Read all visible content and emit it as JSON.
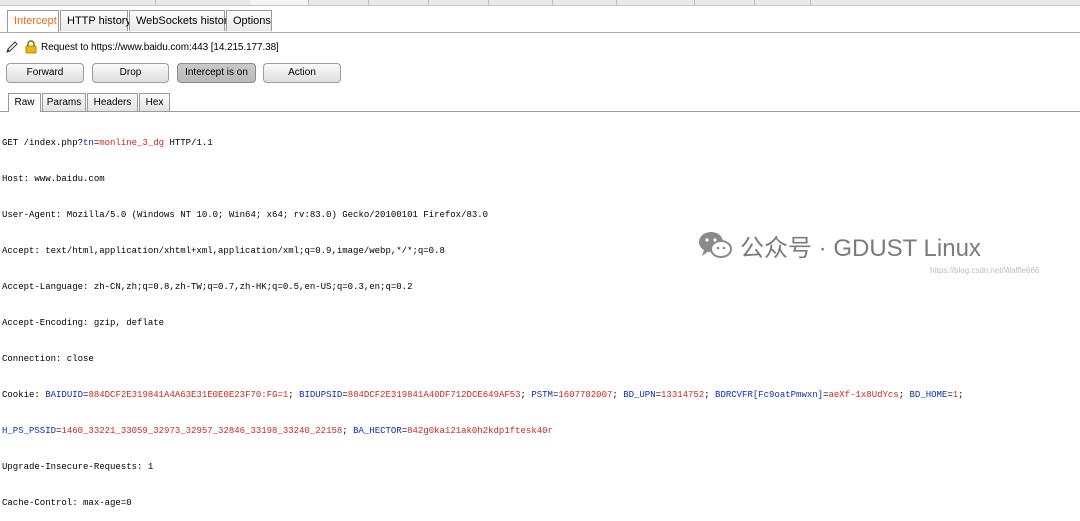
{
  "top_tabs": [
    "Intercept",
    "HTTP history",
    "WebSockets history",
    "Options"
  ],
  "request_label": "Request to https://www.baidu.com:443  [14.215.177.38]",
  "buttons": {
    "forward": "Forward",
    "drop": "Drop",
    "intercept": "Intercept is on",
    "action": "Action"
  },
  "view_tabs": [
    "Raw",
    "Params",
    "Headers",
    "Hex"
  ],
  "request": {
    "line1": {
      "pre": "GET /index.php?",
      "k": "tn",
      "eq": "=",
      "v": "monline_3_dg",
      "post": " HTTP/1.1"
    },
    "host": "Host: www.baidu.com",
    "ua": "User-Agent: Mozilla/5.0 (Windows NT 10.0; Win64; x64; rv:83.0) Gecko/20100101 Firefox/83.0",
    "accept": "Accept: text/html,application/xhtml+xml,application/xml;q=0.9,image/webp,*/*;q=0.8",
    "lang": "Accept-Language: zh-CN,zh;q=0.8,zh-TW;q=0.7,zh-HK;q=0.5,en-US;q=0.3,en;q=0.2",
    "enc": "Accept-Encoding: gzip, deflate",
    "conn": "Connection: close",
    "cookie_prefix": "Cookie: ",
    "cookies1": [
      {
        "k": "BAIDUID",
        "v": "884DCF2E319841A4A63E31E0E0E23F70:FG=1"
      },
      {
        "k": "BIDUPSID",
        "v": "884DCF2E319841A40DF712DCE649AF53"
      },
      {
        "k": "PSTM",
        "v": "1607782007"
      },
      {
        "k": "BD_UPN",
        "v": "13314752"
      },
      {
        "k": "BDRCVFR[Fc9oatPmwxn]",
        "v": "aeXf-1x8UdYcs"
      },
      {
        "k": "BD_HOME",
        "v": "1"
      }
    ],
    "cookies2": [
      {
        "k": "H_PS_PSSID",
        "v": "1460_33221_33059_32973_32957_32846_33198_33240_22158"
      },
      {
        "k": "BA_HECTOR",
        "v": "842g0ka121ak0h2kdp1ftesk40r"
      }
    ],
    "upgrade": "Upgrade-Insecure-Requests: 1",
    "cache": "Cache-Control: max-age=0"
  },
  "watermark": {
    "text": "公众号 · GDUST Linux",
    "url": "https://blog.csdn.net/Waffle666"
  },
  "colors": {
    "active_tab": "#e86a1a",
    "param_key": "#0a2fb0",
    "param_value": "#c9281f",
    "wechat_icon": "#8a8a8a"
  }
}
